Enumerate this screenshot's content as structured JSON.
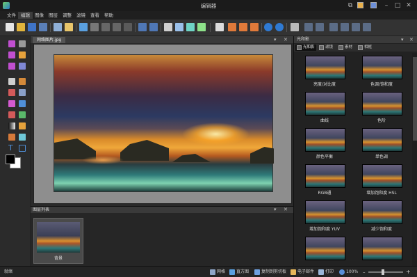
{
  "window": {
    "title": "编辑器"
  },
  "menu": [
    "文件",
    "编辑",
    "图像",
    "图层",
    "调整",
    "滤镜",
    "查看",
    "帮助"
  ],
  "document": {
    "tab": "网络图片.jpg"
  },
  "layers_panel": {
    "title": "图层列表",
    "items": [
      {
        "label": "背景"
      }
    ]
  },
  "right_panel": {
    "title": "光和影",
    "tabs": [
      "光和影",
      "滤镜",
      "素材",
      "相框"
    ],
    "filters": [
      "亮度/对比度",
      "色调/饱和度",
      "曲线",
      "色阶",
      "颜色平衡",
      "单色调",
      "RGB通",
      "增加饱和度 HSL",
      "增加饱和度 YUV",
      "减少饱和度",
      "",
      ""
    ]
  },
  "status": {
    "left": "就绪",
    "grid": "网格",
    "histogram": "直方图",
    "copy_clipboard": "复制到剪切板",
    "email": "电子邮件",
    "print": "打印",
    "zoom": "100%"
  },
  "colors": {
    "accent": "#2f7ad3",
    "bg": "#2b2b2b",
    "panel": "#222222"
  }
}
